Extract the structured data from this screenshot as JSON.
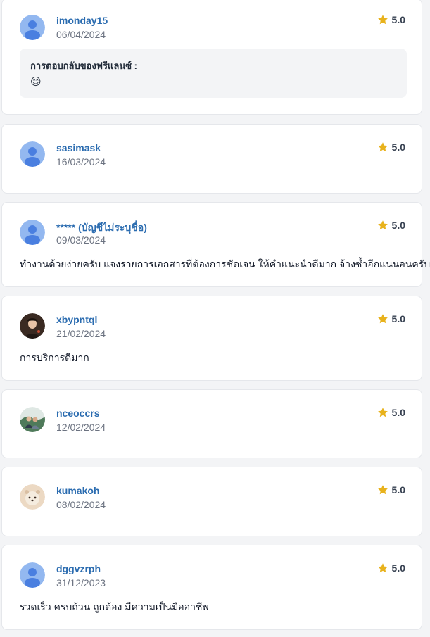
{
  "reviews": [
    {
      "username": "imonday15",
      "date": "06/04/2024",
      "rating": "5.0",
      "avatar": "default-avatar",
      "comment": "",
      "reply": {
        "title": "การตอบกลับของฟรีแลนซ์ :",
        "text": "😊"
      }
    },
    {
      "username": "sasimask",
      "date": "16/03/2024",
      "rating": "5.0",
      "avatar": "default-avatar",
      "comment": ""
    },
    {
      "username": "***** (บัญชีไม่ระบุชื่อ)",
      "date": "09/03/2024",
      "rating": "5.0",
      "avatar": "default-avatar",
      "comment": "ทำงานด้วยง่ายครับ แจงรายการเอกสารที่ต้องการชัดเจน ให้คำแนะนำดีมาก จ้างซ้ำอีกแน่นอนครับ"
    },
    {
      "username": "xbypntql",
      "date": "21/02/2024",
      "rating": "5.0",
      "avatar": "photo-avatar",
      "comment": "การบริการดีมาก"
    },
    {
      "username": "nceoccrs",
      "date": "12/02/2024",
      "rating": "5.0",
      "avatar": "photo-avatar",
      "comment": ""
    },
    {
      "username": "kumakoh",
      "date": "08/02/2024",
      "rating": "5.0",
      "avatar": "bear-avatar",
      "comment": ""
    },
    {
      "username": "dggvzrph",
      "date": "31/12/2023",
      "rating": "5.0",
      "avatar": "default-avatar",
      "comment": "รวดเร็ว ครบถ้วน ถูกต้อง มีความเป็นมืออาชีพ"
    }
  ],
  "colors": {
    "username": "#2b6cb0",
    "star": "#e8b21c",
    "avatar_bg": "#93b8f0",
    "avatar_fg": "#4a7fe0"
  }
}
